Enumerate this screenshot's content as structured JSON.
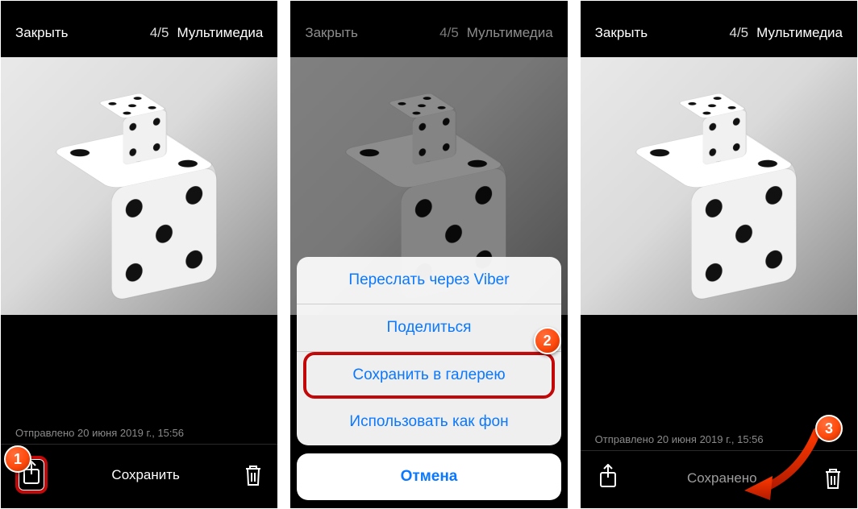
{
  "header": {
    "close_label": "Закрыть",
    "counter": "4/5",
    "multimedia_label": "Мультимедиа"
  },
  "meta": {
    "sent_text": "Отправлено 20 июня 2019 г., 15:56"
  },
  "bottom": {
    "save_label": "Сохранить",
    "saved_label": "Сохранено"
  },
  "action_sheet": {
    "forward_viber": "Переслать через Viber",
    "share": "Поделиться",
    "save_gallery": "Сохранить в галерею",
    "use_as_wallpaper": "Использовать как фон",
    "cancel": "Отмена"
  },
  "badges": {
    "step1": "1",
    "step2": "2",
    "step3": "3"
  }
}
